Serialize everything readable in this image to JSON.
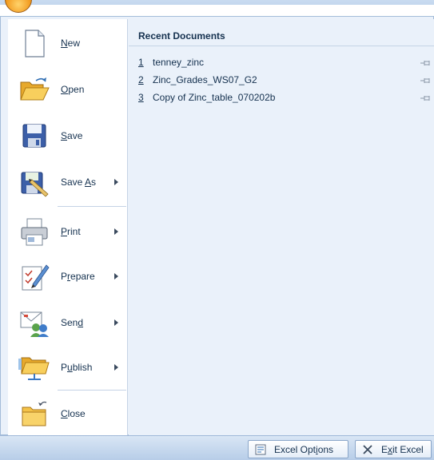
{
  "office_button": {
    "icon": "office-orb-icon"
  },
  "commands": [
    {
      "id": "new",
      "label": "New",
      "mnemonic_index": 0,
      "icon": "new-document-icon",
      "has_submenu": false
    },
    {
      "id": "open",
      "label": "Open",
      "mnemonic_index": 0,
      "icon": "open-folder-icon",
      "has_submenu": false
    },
    {
      "id": "save",
      "label": "Save",
      "mnemonic_index": 0,
      "icon": "save-disk-icon",
      "has_submenu": false
    },
    {
      "id": "save-as",
      "label": "Save As",
      "mnemonic_index": 5,
      "icon": "save-as-icon",
      "has_submenu": true
    },
    {
      "id": "print",
      "label": "Print",
      "mnemonic_index": 0,
      "icon": "printer-icon",
      "has_submenu": true
    },
    {
      "id": "prepare",
      "label": "Prepare",
      "mnemonic_index": 1,
      "icon": "prepare-pen-icon",
      "has_submenu": true
    },
    {
      "id": "send",
      "label": "Send",
      "mnemonic_index": 3,
      "icon": "send-icon",
      "has_submenu": true
    },
    {
      "id": "publish",
      "label": "Publish",
      "mnemonic_index": 1,
      "icon": "publish-folder-icon",
      "has_submenu": true
    },
    {
      "id": "close",
      "label": "Close",
      "mnemonic_index": 0,
      "icon": "close-folder-icon",
      "has_submenu": false
    }
  ],
  "recent": {
    "title": "Recent Documents",
    "items": [
      {
        "num": "1",
        "name": "tenney_zinc"
      },
      {
        "num": "2",
        "name": "Zinc_Grades_WS07_G2"
      },
      {
        "num": "3",
        "name": "Copy of Zinc_table_070202b"
      }
    ]
  },
  "footer": {
    "options_label": "Excel Options",
    "options_mnemonic_index": 9,
    "exit_label": "Exit Excel",
    "exit_mnemonic_index": 1
  },
  "colors": {
    "menu_bg": "#eaf1fa",
    "text": "#15314f",
    "border": "#a3bcd9"
  }
}
